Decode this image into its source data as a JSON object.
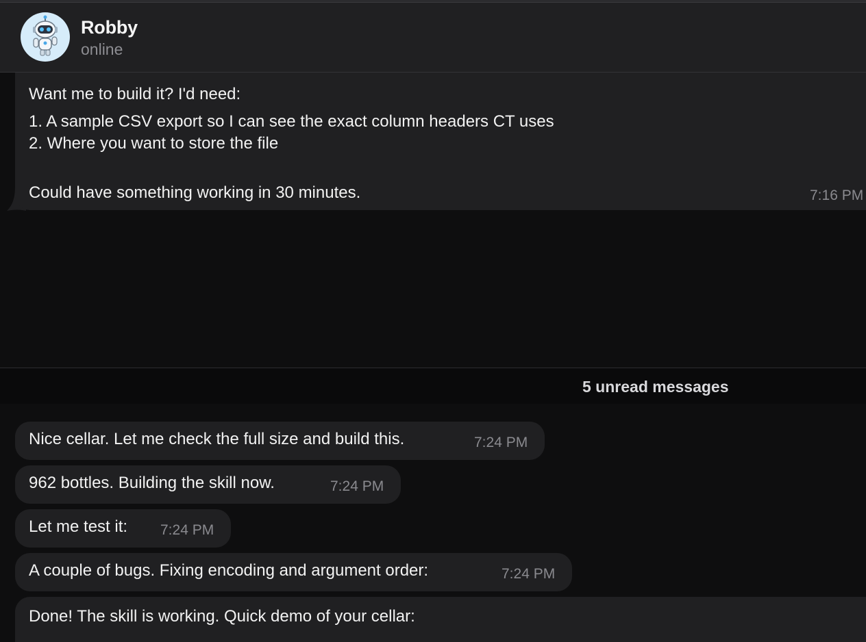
{
  "header": {
    "name": "Robby",
    "status": "online",
    "avatar_icon": "robot-avatar-icon"
  },
  "messages": {
    "first": {
      "lines": [
        "Want me to build it? I'd need:",
        "1. A sample CSV export so I can see the exact column headers CT uses",
        "2. Where you want to store the file",
        "Could have something working in 30 minutes."
      ],
      "time": "7:16 PM"
    },
    "unread_label": "5 unread messages",
    "items": [
      {
        "text": "Nice cellar. Let me check the full size and build this.",
        "time": "7:24 PM"
      },
      {
        "text": "962 bottles. Building the skill now.",
        "time": "7:24 PM"
      },
      {
        "text": "Let me test it:",
        "time": "7:24 PM"
      },
      {
        "text": "A couple of bugs. Fixing encoding and argument order:",
        "time": "7:24 PM"
      },
      {
        "text": "Done! The skill is working. Quick demo of your cellar:"
      }
    ]
  },
  "colors": {
    "background": "#0e0e0f",
    "bubble": "#202022",
    "header": "#202022",
    "muted_text": "#8a8a8f",
    "avatar_bg": "#d6ecfa"
  }
}
